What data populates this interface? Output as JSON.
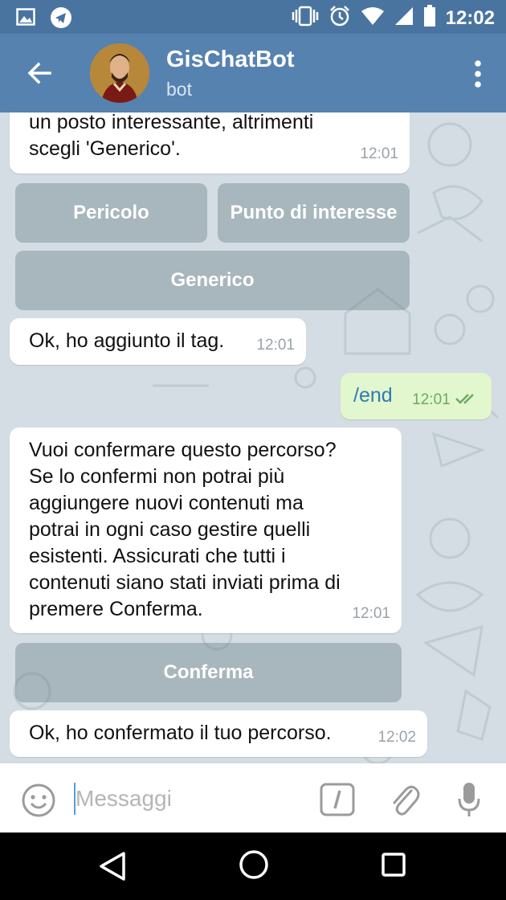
{
  "status_bar": {
    "time": "12:02",
    "left_icons": [
      "image-icon",
      "telegram-icon"
    ],
    "right_icons": [
      "vibrate-icon",
      "alarm-icon",
      "wifi-icon",
      "signal-icon",
      "battery-icon"
    ]
  },
  "header": {
    "title": "GisChatBot",
    "subtitle": "bot"
  },
  "messages": [
    {
      "side": "in",
      "text": "un posto interessante, altrimenti\nscegli 'Generico'.",
      "time": "12:01"
    },
    {
      "side": "in",
      "text": "Ok, ho aggiunto il tag.",
      "time": "12:01"
    },
    {
      "side": "out",
      "text": "/end",
      "time": "12:01"
    },
    {
      "side": "in",
      "text": "Vuoi confermare questo percorso?\nSe lo confermi non potrai più\naggiungere nuovi contenuti ma\npotrai in ogni caso gestire quelli\nesistenti. Assicurati che tutti i\ncontenuti siano stati inviati prima di\npremere Conferma.",
      "time": "12:01"
    },
    {
      "side": "in",
      "text": "Ok, ho confermato il tuo percorso.",
      "time": "12:02"
    }
  ],
  "keyboards": {
    "tag": [
      "Pericolo",
      "Punto di interesse",
      "Generico"
    ],
    "confirm": [
      "Conferma"
    ]
  },
  "input": {
    "placeholder": "Messaggi",
    "value": ""
  },
  "colors": {
    "status_bar": "#4a74a0",
    "app_bar": "#5682b0",
    "chat_background": "#d3dde3",
    "outgoing_bubble": "#e2f7cd",
    "read_checks": "#6ea963"
  }
}
